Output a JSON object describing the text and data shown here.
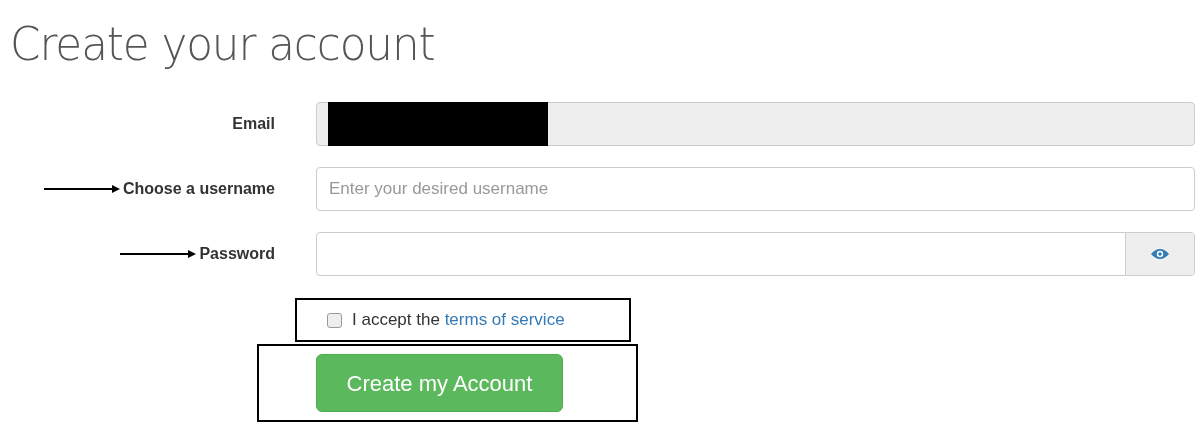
{
  "title": "Create your account",
  "fields": [
    {
      "kind": "text",
      "label": "Email",
      "disabled": true,
      "redacted": true,
      "annotated": false
    },
    {
      "kind": "text",
      "label": "Choose a username",
      "placeholder": "Enter your desired username",
      "disabled": false,
      "annotated": true
    },
    {
      "kind": "password",
      "label": "Password",
      "disabled": false,
      "annotated": true
    }
  ],
  "terms": {
    "checked": false,
    "text": "I accept the",
    "link": "terms of service",
    "highlighted": true
  },
  "submit": {
    "label": "Create my Account",
    "highlighted": true
  }
}
